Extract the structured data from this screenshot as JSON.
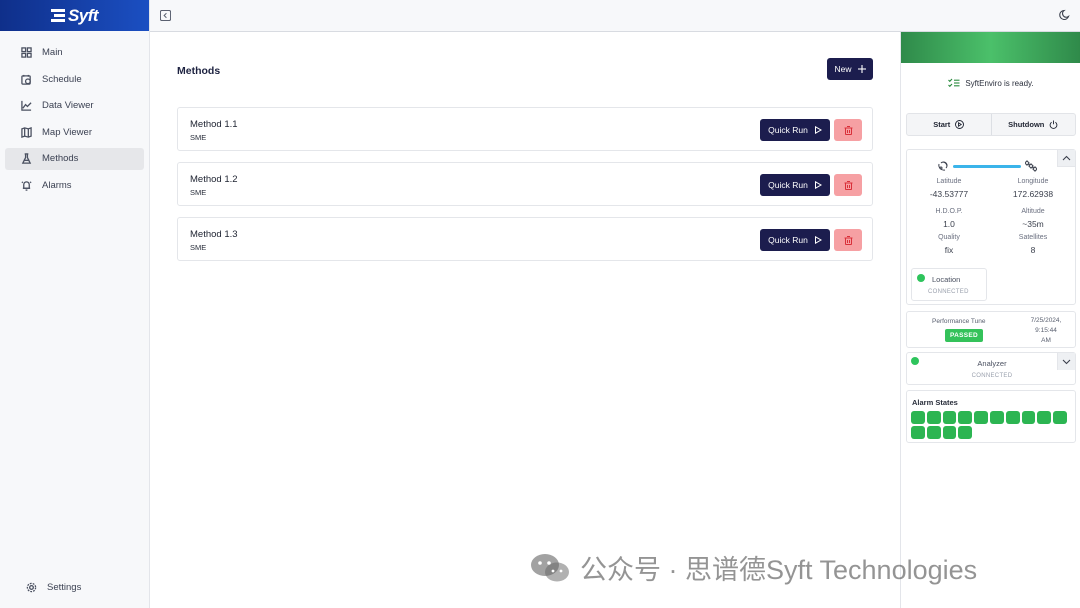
{
  "app": {
    "logo_text": "Syft"
  },
  "sidebar": {
    "items": [
      {
        "label": "Main",
        "icon": "grid-icon"
      },
      {
        "label": "Schedule",
        "icon": "calendar-clock-icon"
      },
      {
        "label": "Data Viewer",
        "icon": "line-chart-icon"
      },
      {
        "label": "Map Viewer",
        "icon": "map-icon"
      },
      {
        "label": "Methods",
        "icon": "flask-icon",
        "active": true
      },
      {
        "label": "Alarms",
        "icon": "alarm-bell-icon"
      }
    ],
    "settings_label": "Settings"
  },
  "main": {
    "title": "Methods",
    "new_label": "New",
    "methods": [
      {
        "name": "Method 1.1",
        "sub": "SME",
        "quick_run_label": "Quick Run"
      },
      {
        "name": "Method 1.2",
        "sub": "SME",
        "quick_run_label": "Quick Run"
      },
      {
        "name": "Method 1.3",
        "sub": "SME",
        "quick_run_label": "Quick Run"
      }
    ]
  },
  "status": {
    "ready_text": "SyftEnviro is ready.",
    "start_label": "Start",
    "shutdown_label": "Shutdown",
    "gps": {
      "latitude_label": "Latitude",
      "latitude": "-43.53777",
      "longitude_label": "Longitude",
      "longitude": "172.62938",
      "hdop_label": "H.D.O.P.",
      "hdop": "1.0",
      "altitude_label": "Altitude",
      "altitude": "~35m",
      "quality_label": "Quality",
      "quality": "fix",
      "satellites_label": "Satellites",
      "satellites": "8"
    },
    "location": {
      "label": "Location",
      "state": "CONNECTED"
    },
    "performance": {
      "label": "Performance Tune",
      "badge": "PASSED",
      "date": "7/25/2024,",
      "time": "9:15:44",
      "ampm": "AM"
    },
    "analyzer": {
      "label": "Analyzer",
      "state": "CONNECTED"
    },
    "alarms": {
      "title": "Alarm States",
      "count": 14
    },
    "colors": {
      "ok": "#2cb552",
      "navy": "#1c1d4e",
      "danger": "#f6a0a3"
    }
  },
  "watermark": {
    "text": "公众号 · 思谱德Syft Technologies"
  }
}
